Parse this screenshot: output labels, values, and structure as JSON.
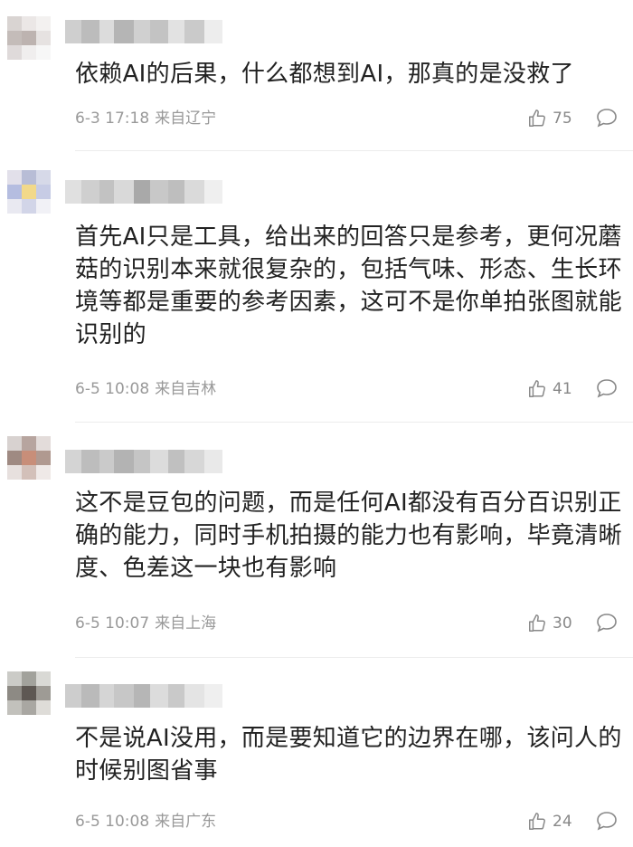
{
  "comments": [
    {
      "text": "依赖AI的后果，什么都想到AI，那真的是没救了",
      "time": "6-3 17:18",
      "location": "来自辽宁",
      "likes": "75",
      "avatar_colors": [
        "#d9d4d2",
        "#ebe7e6",
        "#f3f1f0",
        "#c4bcb9",
        "#bdb3b0",
        "#e6e2e1",
        "#dfdada",
        "#f0eeee",
        "#f7f7f7"
      ],
      "name_colors": [
        "#cfcfcf",
        "#bcbcbc",
        "#dcdcdc",
        "#b5b5b5",
        "#d0d0d0",
        "#c3c3c3",
        "#e2e2e2",
        "#cacaca",
        "#ededed"
      ]
    },
    {
      "text": "首先AI只是工具，给出来的回答只是参考，更何况蘑菇的识别本来就很复杂的，包括气味、形态、生长环境等都是重要的参考因素，这可不是你单拍张图就能识别的",
      "time": "6-5 10:08",
      "location": "来自吉林",
      "likes": "41",
      "avatar_colors": [
        "#e2e0ea",
        "#b8bdd6",
        "#d6d9e8",
        "#b5bde0",
        "#f2d98a",
        "#c7cce5",
        "#e9e9f1",
        "#d2d5e8",
        "#f1f1f6"
      ],
      "name_colors": [
        "#e0e0e0",
        "#cfcfcf",
        "#c2c2c2",
        "#d9d9d9",
        "#a9a9a9",
        "#c8c8c8",
        "#bebebe",
        "#dadada",
        "#efefef"
      ]
    },
    {
      "text": "这不是豆包的问题，而是任何AI都没有百分百识别正确的能力，同时手机拍摄的能力也有影响，毕竟清晰度、色差这一块也有影响",
      "time": "6-5 10:07",
      "location": "来自上海",
      "likes": "30",
      "avatar_colors": [
        "#d8d2d0",
        "#b7a59f",
        "#e3dcda",
        "#9f8a82",
        "#c88e79",
        "#b09990",
        "#e7e0de",
        "#d3c0b9",
        "#efe9e7"
      ],
      "name_colors": [
        "#d4d4d4",
        "#bdbdbd",
        "#cacaca",
        "#b3b3b3",
        "#c5c5c5",
        "#dcdcdc",
        "#c0c0c0",
        "#d7d7d7",
        "#e9e9e9"
      ]
    },
    {
      "text": "不是说AI没用，而是要知道它的边界在哪，该问人的时候别图省事",
      "time": "6-5 10:08",
      "location": "来自广东",
      "likes": "24",
      "avatar_colors": [
        "#cbcbc7",
        "#a2a29c",
        "#d9d9d5",
        "#8d8a84",
        "#5e5853",
        "#9e9b95",
        "#c2c1bc",
        "#a9a7a2",
        "#dedcd8"
      ],
      "name_colors": [
        "#cdcdcd",
        "#bababa",
        "#d5d5d5",
        "#c7c7c7",
        "#b6b6b6",
        "#dcdcdc",
        "#c9c9c9",
        "#e4e4e4",
        "#efefef"
      ]
    }
  ]
}
